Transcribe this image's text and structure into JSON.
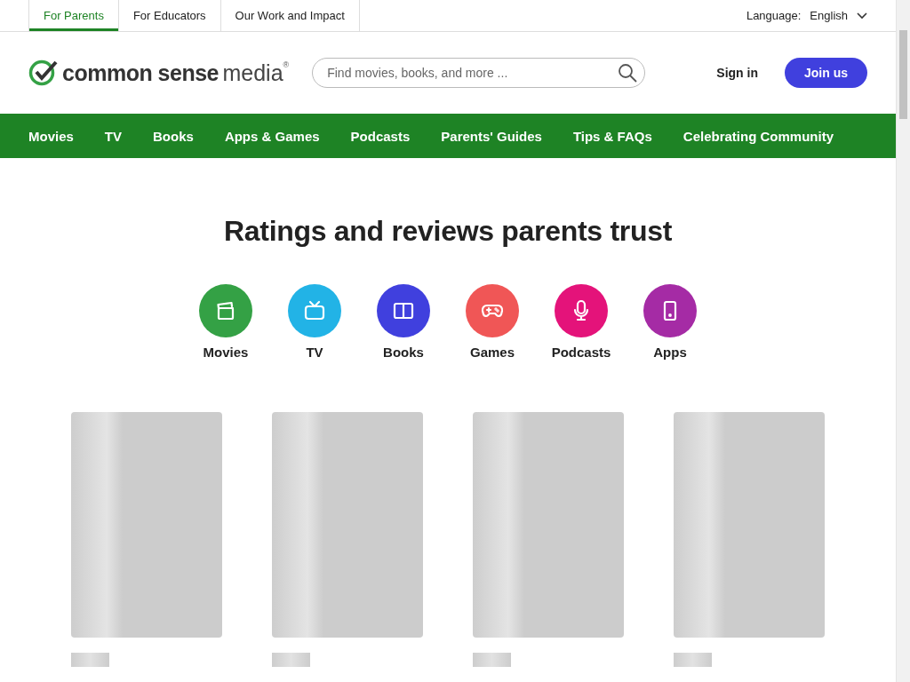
{
  "top_tabs": [
    {
      "label": "For Parents",
      "selected": true
    },
    {
      "label": "For Educators",
      "selected": false
    },
    {
      "label": "Our Work and Impact",
      "selected": false
    }
  ],
  "language": {
    "label": "Language:",
    "value": "English"
  },
  "logo": {
    "text_bold": "common sense",
    "text_light": "media",
    "mark": "®"
  },
  "search": {
    "placeholder": "Find movies, books, and more ..."
  },
  "sign_in": "Sign in",
  "join": "Join us",
  "nav": [
    "Movies",
    "TV",
    "Books",
    "Apps & Games",
    "Podcasts",
    "Parents' Guides",
    "Tips & FAQs",
    "Celebrating Community"
  ],
  "heading": "Ratings and reviews parents trust",
  "categories": [
    {
      "label": "Movies",
      "kind": "movie",
      "color": "#34a145"
    },
    {
      "label": "TV",
      "kind": "tv",
      "color": "#22b3e6"
    },
    {
      "label": "Books",
      "kind": "book",
      "color": "#4040de"
    },
    {
      "label": "Games",
      "kind": "game",
      "color": "#f05656"
    },
    {
      "label": "Podcasts",
      "kind": "podcast",
      "color": "#e4137a"
    },
    {
      "label": "Apps",
      "kind": "app",
      "color": "#a52ba5"
    }
  ],
  "cards": [
    {
      "kind": "placeholder"
    },
    {
      "kind": "placeholder"
    },
    {
      "kind": "placeholder"
    },
    {
      "kind": "placeholder"
    }
  ]
}
